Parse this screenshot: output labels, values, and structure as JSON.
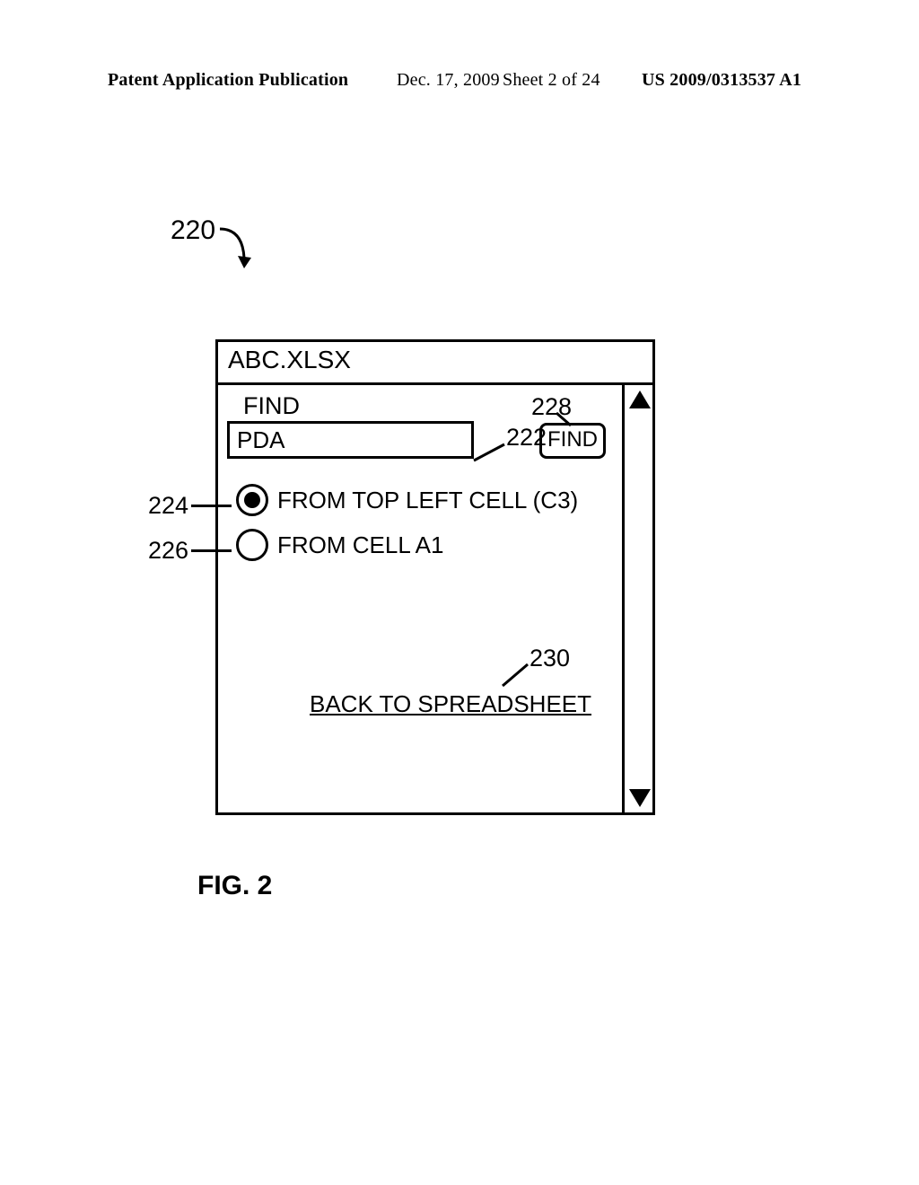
{
  "header": {
    "pub_type": "Patent Application Publication",
    "pub_date": "Dec. 17, 2009",
    "sheet": "Sheet 2 of 24",
    "pub_num": "US 2009/0313537 A1"
  },
  "figure": {
    "ref_main": "220",
    "label": "FIG. 2"
  },
  "window": {
    "title": "ABC.XLSX",
    "find_label": "FIND",
    "find_value": "PDA",
    "find_button": "FIND",
    "option1": "FROM TOP LEFT CELL (C3)",
    "option2": "FROM CELL A1",
    "back_link": "BACK TO SPREADSHEET"
  },
  "callouts": {
    "c222": "222",
    "c224": "224",
    "c226": "226",
    "c228": "228",
    "c230": "230"
  }
}
